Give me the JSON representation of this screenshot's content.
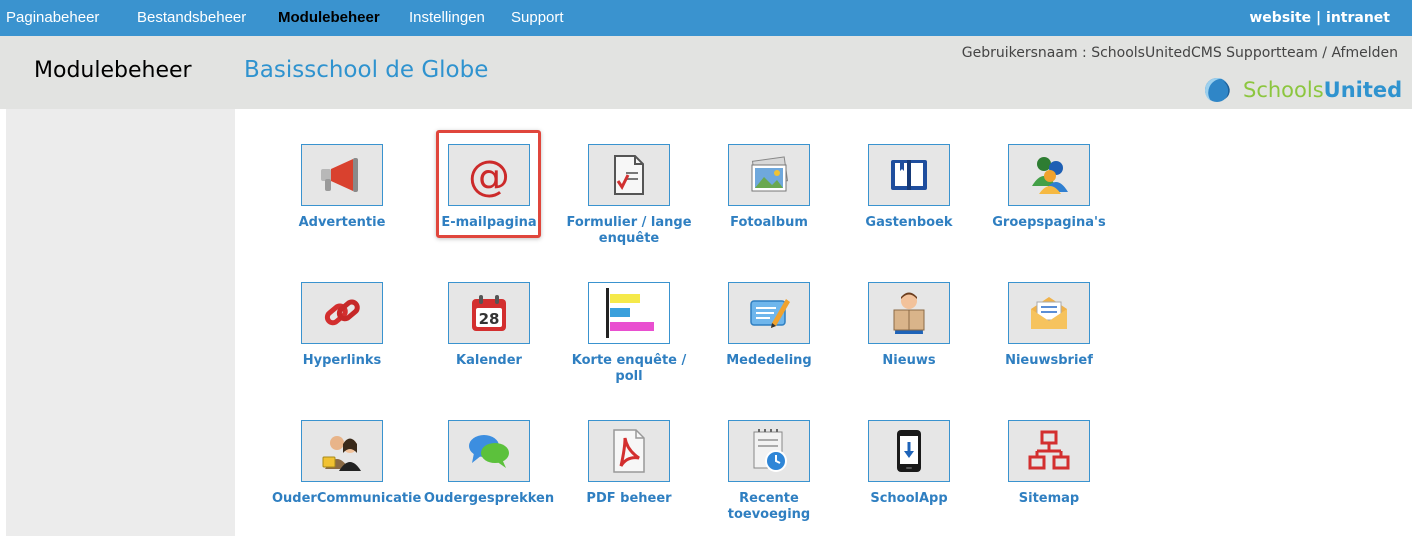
{
  "topnav": {
    "items": [
      {
        "label": "Paginabeheer",
        "active": false
      },
      {
        "label": "Bestandsbeheer",
        "active": false
      },
      {
        "label": "Modulebeheer",
        "active": true
      },
      {
        "label": "Instellingen",
        "active": false
      },
      {
        "label": "Support",
        "active": false
      }
    ],
    "right_links": {
      "website": "website",
      "separator": "|",
      "intranet": "intranet"
    },
    "bar_color": "#3a93cf"
  },
  "header": {
    "section_title": "Modulebeheer",
    "school_name": "Basisschool de Globe",
    "user_label": "Gebruikersnaam : SchoolsUnitedCMS Supportteam",
    "user_separator": "/",
    "logout_label": "Afmelden",
    "logo": {
      "part1": "Schools",
      "part2": "United",
      "icon": "globe-logo-icon"
    }
  },
  "modules": [
    {
      "label": "Advertentie",
      "icon": "megaphone-icon",
      "selected": false
    },
    {
      "label": "E-mailpagina",
      "icon": "at-sign-icon",
      "selected": true
    },
    {
      "label": "Formulier / lange enquête",
      "icon": "form-icon",
      "selected": false
    },
    {
      "label": "Fotoalbum",
      "icon": "photo-album-icon",
      "selected": false
    },
    {
      "label": "Gastenboek",
      "icon": "guestbook-icon",
      "selected": false
    },
    {
      "label": "Groepspagina's",
      "icon": "group-icon",
      "selected": false
    },
    {
      "label": "Hyperlinks",
      "icon": "link-icon",
      "selected": false
    },
    {
      "label": "Kalender",
      "icon": "calendar-icon",
      "selected": false,
      "calendar_day": "28"
    },
    {
      "label": "Korte enquête / poll",
      "icon": "poll-icon",
      "selected": false
    },
    {
      "label": "Mededeling",
      "icon": "announcement-icon",
      "selected": false
    },
    {
      "label": "Nieuws",
      "icon": "news-icon",
      "selected": false
    },
    {
      "label": "Nieuwsbrief",
      "icon": "newsletter-icon",
      "selected": false
    },
    {
      "label": "OuderCommunicatie",
      "icon": "parent-communication-icon",
      "selected": false
    },
    {
      "label": "Oudergesprekken",
      "icon": "chat-bubbles-icon",
      "selected": false
    },
    {
      "label": "PDF beheer",
      "icon": "pdf-icon",
      "selected": false
    },
    {
      "label": "Recente toevoeging",
      "icon": "recent-icon",
      "selected": false
    },
    {
      "label": "SchoolApp",
      "icon": "phone-app-icon",
      "selected": false
    },
    {
      "label": "Sitemap",
      "icon": "sitemap-icon",
      "selected": false
    }
  ],
  "colors": {
    "accent": "#3a93cf",
    "label_blue": "#2f7fc1",
    "selection_border": "#e0463c",
    "header_bg": "#e2e3e1",
    "sidebar_bg": "#ececec"
  }
}
